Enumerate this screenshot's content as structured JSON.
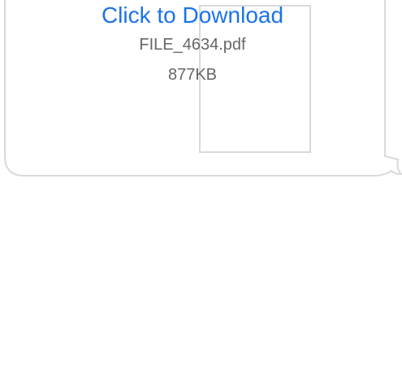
{
  "attachment": {
    "download_label": "Click to Download",
    "file_name": "FILE_4634.pdf",
    "file_size": "877KB"
  },
  "colors": {
    "link": "#1a73e8",
    "meta_text": "#666666",
    "bubble_border": "#d9d9d9",
    "background": "#ffffff"
  }
}
